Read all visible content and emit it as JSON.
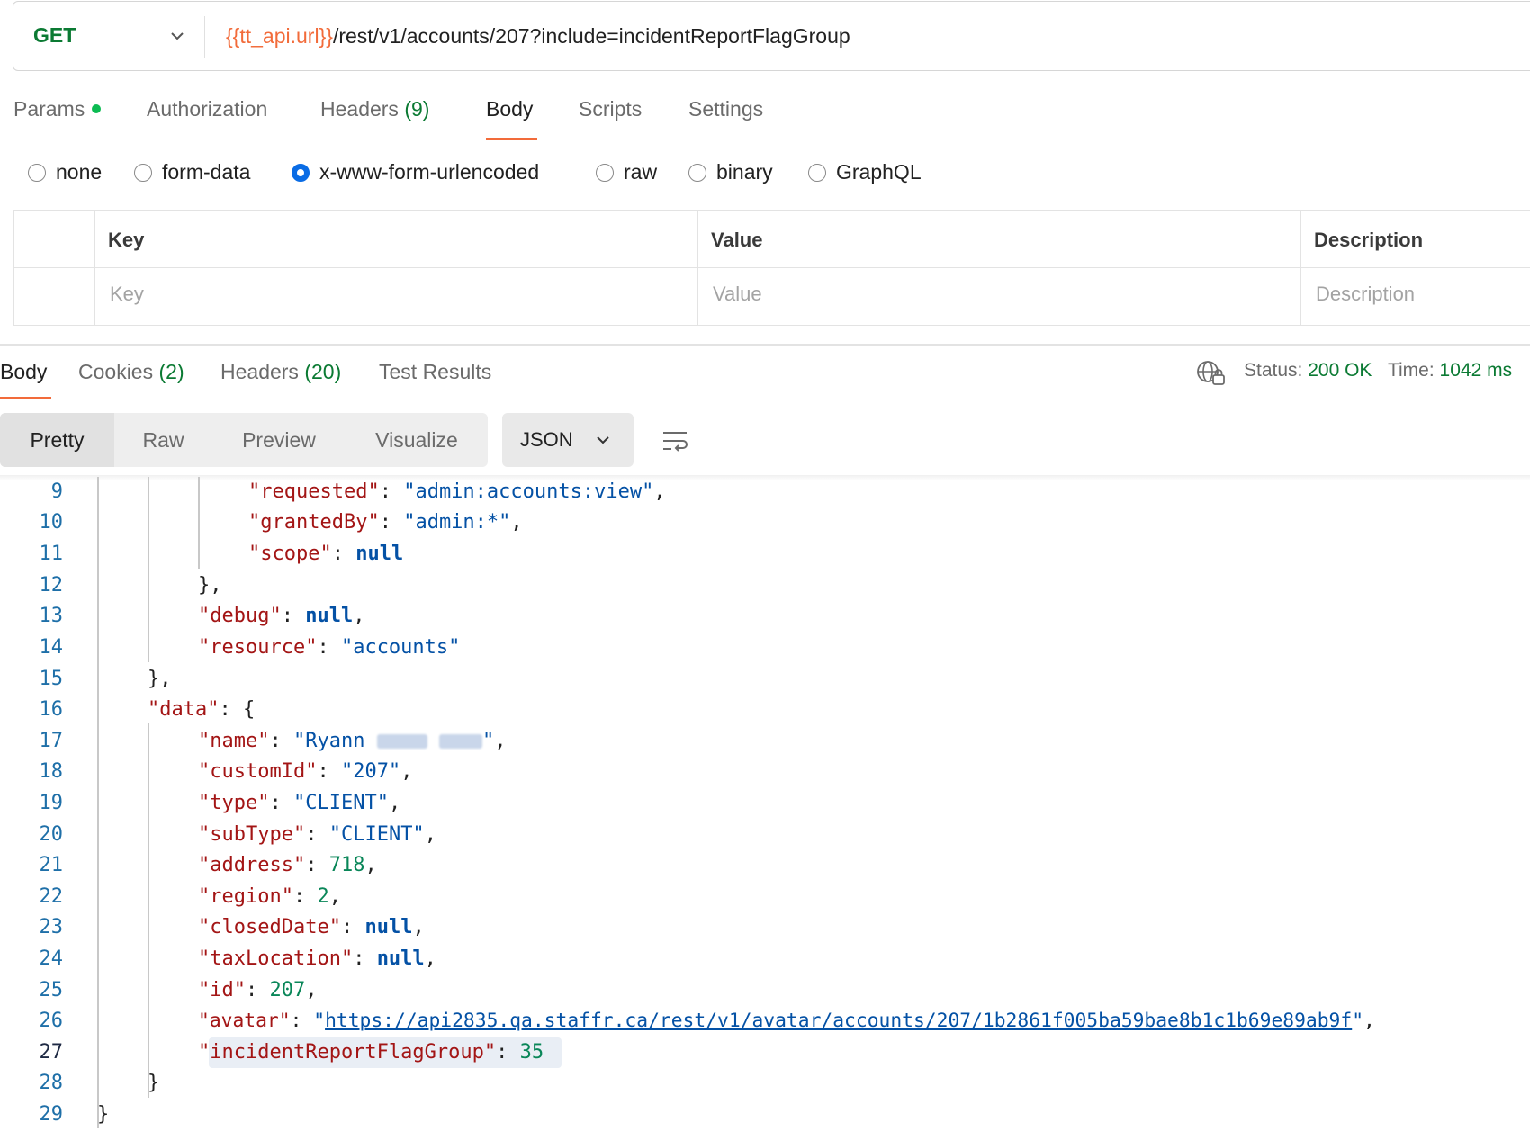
{
  "request": {
    "method": "GET",
    "url_var": "{{tt_api.url}}",
    "url_path": "/rest/v1/accounts/207?include=incidentReportFlagGroup"
  },
  "request_tabs": {
    "params": "Params",
    "authorization": "Authorization",
    "headers": "Headers",
    "headers_count": "(9)",
    "body": "Body",
    "scripts": "Scripts",
    "settings": "Settings"
  },
  "body_types": {
    "none": "none",
    "form_data": "form-data",
    "urlencoded": "x-www-form-urlencoded",
    "raw": "raw",
    "binary": "binary",
    "graphql": "GraphQL",
    "selected": "x-www-form-urlencoded"
  },
  "kv_table": {
    "headers": {
      "key": "Key",
      "value": "Value",
      "description": "Description"
    },
    "placeholders": {
      "key": "Key",
      "value": "Value",
      "description": "Description"
    }
  },
  "response_tabs": {
    "body": "Body",
    "cookies": "Cookies",
    "cookies_count": "(2)",
    "headers": "Headers",
    "headers_count": "(20)",
    "tests": "Test Results"
  },
  "status": {
    "status_label": "Status:",
    "status_value": "200 OK",
    "time_label": "Time:",
    "time_value": "1042 ms"
  },
  "view_modes": {
    "pretty": "Pretty",
    "raw": "Raw",
    "preview": "Preview",
    "visualize": "Visualize",
    "format": "JSON"
  },
  "code": {
    "line_numbers": [
      "9",
      "10",
      "11",
      "12",
      "13",
      "14",
      "15",
      "16",
      "17",
      "18",
      "19",
      "20",
      "21",
      "22",
      "23",
      "24",
      "25",
      "26",
      "27",
      "28",
      "29"
    ],
    "requested_key": "\"requested\"",
    "requested_val": "\"admin:accounts:view\"",
    "grantedBy_key": "\"grantedBy\"",
    "grantedBy_val": "\"admin:*\"",
    "scope_key": "\"scope\"",
    "null": "null",
    "close_obj_comma": "},",
    "debug_key": "\"debug\"",
    "resource_key": "\"resource\"",
    "resource_val": "\"accounts\"",
    "data_key": "\"data\"",
    "name_key": "\"name\"",
    "name_val": "\"Ryann",
    "customId_key": "\"customId\"",
    "customId_val": "\"207\"",
    "type_key": "\"type\"",
    "type_val": "\"CLIENT\"",
    "subType_key": "\"subType\"",
    "subType_val": "\"CLIENT\"",
    "address_key": "\"address\"",
    "address_val": "718",
    "region_key": "\"region\"",
    "region_val": "2",
    "closedDate_key": "\"closedDate\"",
    "taxLocation_key": "\"taxLocation\"",
    "id_key": "\"id\"",
    "id_val": "207",
    "avatar_key": "\"avatar\"",
    "avatar_url": "https://api2835.qa.staffr.ca/rest/v1/avatar/accounts/207/1b2861f005ba59bae8b1c1b69e89ab9f",
    "flag_key": "\"incidentReportFlagGroup\"",
    "flag_val": "35",
    "close_brace": "}"
  }
}
